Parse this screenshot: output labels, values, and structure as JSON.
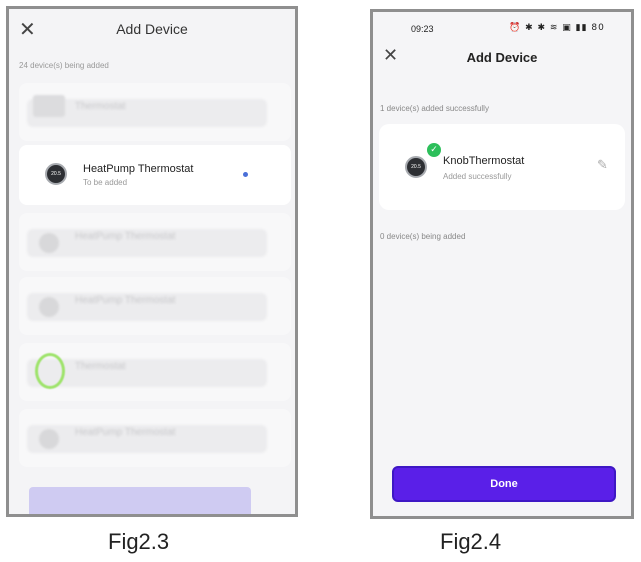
{
  "fig23": {
    "title": "Add Device",
    "count_text": "24 device(s) being added",
    "active_device": {
      "name": "HeatPump Thermostat",
      "status": "To be added"
    },
    "blurred_items": [
      "Thermostat",
      "HeatPump Thermostat",
      "HeatPump Thermostat",
      "Thermostat",
      "HeatPump Thermostat"
    ],
    "caption": "Fig2.3"
  },
  "fig24": {
    "status_time": "09:23",
    "status_icons": "⏰ ✱ ✱ ≋ ▣ ▮▮ 80",
    "title": "Add Device",
    "success_text": "1 device(s) added successfully",
    "device": {
      "name": "KnobThermostat",
      "status": "Added successfully"
    },
    "adding_text": "0 device(s) being added",
    "done_label": "Done",
    "caption": "Fig2.4"
  },
  "colors": {
    "accent": "#5a1fe8",
    "success": "#2dbf5b",
    "pending_btn": "#cfcbf2"
  },
  "icons": {
    "close": "close-icon",
    "check": "check-icon",
    "edit": "edit-pencil-icon",
    "thermostat": "thermostat-icon"
  }
}
